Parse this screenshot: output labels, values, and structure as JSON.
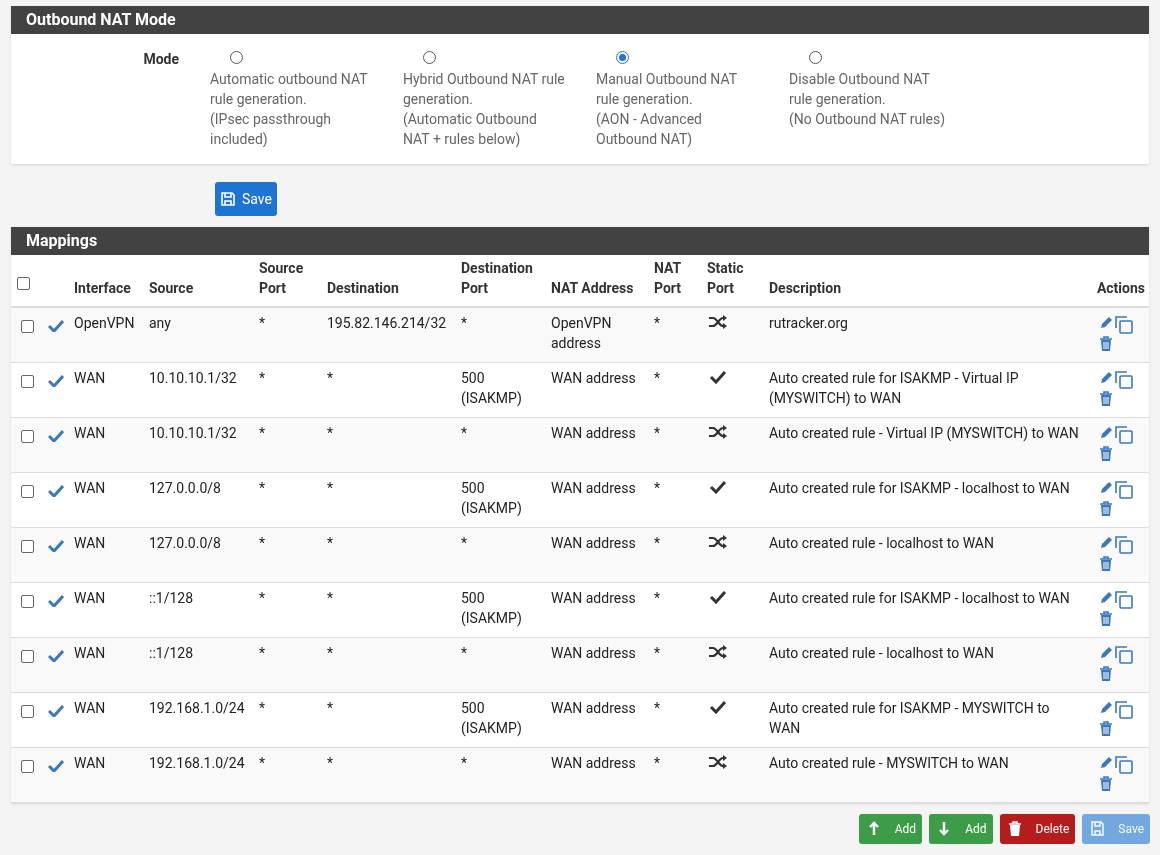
{
  "mode_panel": {
    "title": "Outbound NAT Mode",
    "label": "Mode",
    "options": [
      {
        "text": "Automatic outbound NAT rule generation.\n(IPsec passthrough included)",
        "selected": false
      },
      {
        "text": "Hybrid Outbound NAT rule generation.\n(Automatic Outbound NAT + rules below)",
        "selected": false
      },
      {
        "text": "Manual Outbound NAT rule generation.\n(AON - Advanced Outbound NAT)",
        "selected": true
      },
      {
        "text": "Disable Outbound NAT rule generation.\n(No Outbound NAT rules)",
        "selected": false
      }
    ],
    "save_button": "Save"
  },
  "mappings": {
    "title": "Mappings",
    "select_all_checked": false,
    "columns": [
      "Interface",
      "Source",
      "Source Port",
      "Destination",
      "Destination Port",
      "NAT Address",
      "NAT Port",
      "Static Port",
      "Description",
      "Actions"
    ],
    "rows": [
      {
        "checked": false,
        "enabled": true,
        "interface": "OpenVPN",
        "source": "any",
        "source_port": "*",
        "destination": "195.82.146.214/32",
        "destination_port": "*",
        "nat_address": "OpenVPN address",
        "nat_port": "*",
        "static_port": false,
        "description": "rutracker.org"
      },
      {
        "checked": false,
        "enabled": true,
        "interface": "WAN",
        "source": "10.10.10.1/32",
        "source_port": "*",
        "destination": "*",
        "destination_port": "500 (ISAKMP)",
        "nat_address": "WAN address",
        "nat_port": "*",
        "static_port": true,
        "description": "Auto created rule for ISAKMP - Virtual IP (MYSWITCH) to WAN"
      },
      {
        "checked": false,
        "enabled": true,
        "interface": "WAN",
        "source": "10.10.10.1/32",
        "source_port": "*",
        "destination": "*",
        "destination_port": "*",
        "nat_address": "WAN address",
        "nat_port": "*",
        "static_port": false,
        "description": "Auto created rule - Virtual IP (MYSWITCH) to WAN"
      },
      {
        "checked": false,
        "enabled": true,
        "interface": "WAN",
        "source": "127.0.0.0/8",
        "source_port": "*",
        "destination": "*",
        "destination_port": "500 (ISAKMP)",
        "nat_address": "WAN address",
        "nat_port": "*",
        "static_port": true,
        "description": "Auto created rule for ISAKMP - localhost to WAN"
      },
      {
        "checked": false,
        "enabled": true,
        "interface": "WAN",
        "source": "127.0.0.0/8",
        "source_port": "*",
        "destination": "*",
        "destination_port": "*",
        "nat_address": "WAN address",
        "nat_port": "*",
        "static_port": false,
        "description": "Auto created rule - localhost to WAN"
      },
      {
        "checked": false,
        "enabled": true,
        "interface": "WAN",
        "source": "::1/128",
        "source_port": "*",
        "destination": "*",
        "destination_port": "500 (ISAKMP)",
        "nat_address": "WAN address",
        "nat_port": "*",
        "static_port": true,
        "description": "Auto created rule for ISAKMP - localhost to WAN"
      },
      {
        "checked": false,
        "enabled": true,
        "interface": "WAN",
        "source": "::1/128",
        "source_port": "*",
        "destination": "*",
        "destination_port": "*",
        "nat_address": "WAN address",
        "nat_port": "*",
        "static_port": false,
        "description": "Auto created rule - localhost to WAN"
      },
      {
        "checked": false,
        "enabled": true,
        "interface": "WAN",
        "source": "192.168.1.0/24",
        "source_port": "*",
        "destination": "*",
        "destination_port": "500 (ISAKMP)",
        "nat_address": "WAN address",
        "nat_port": "*",
        "static_port": true,
        "description": "Auto created rule for ISAKMP - MYSWITCH to WAN"
      },
      {
        "checked": false,
        "enabled": true,
        "interface": "WAN",
        "source": "192.168.1.0/24",
        "source_port": "*",
        "destination": "*",
        "destination_port": "*",
        "nat_address": "WAN address",
        "nat_port": "*",
        "static_port": false,
        "description": "Auto created rule - MYSWITCH to WAN"
      }
    ]
  },
  "footer_buttons": [
    {
      "kind": "add_top",
      "label": "Add",
      "disabled": false
    },
    {
      "kind": "add_bottom",
      "label": "Add",
      "disabled": false
    },
    {
      "kind": "delete",
      "label": "Delete",
      "disabled": false
    },
    {
      "kind": "save",
      "label": "Save",
      "disabled": true
    }
  ]
}
